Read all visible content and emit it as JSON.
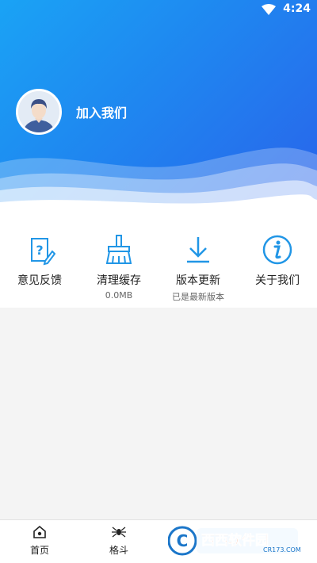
{
  "status_bar": {
    "time": "4:24",
    "icons": [
      "wifi-icon"
    ]
  },
  "profile": {
    "join_label": "加入我们",
    "avatar_icon": "user-avatar"
  },
  "menu": [
    {
      "label": "意见反馈",
      "icon": "feedback-icon"
    },
    {
      "label": "清理缓存",
      "sub": "0.0MB",
      "icon": "broom-icon"
    },
    {
      "label": "版本更新",
      "sub": "已是最新版本",
      "icon": "download-icon"
    },
    {
      "label": "关于我们",
      "icon": "info-icon"
    }
  ],
  "bottom_nav": [
    {
      "label": "首页",
      "icon": "home-icon"
    },
    {
      "label": "格斗",
      "icon": "spider-icon"
    },
    {
      "label": "",
      "icon": ""
    },
    {
      "label": "",
      "icon": ""
    }
  ],
  "watermark": {
    "text": "西西软件园",
    "url_text": "CR173.COM"
  },
  "colors": {
    "header_start": "#1aa3f5",
    "header_end": "#2a62ea",
    "icon_blue": "#2196e6"
  }
}
